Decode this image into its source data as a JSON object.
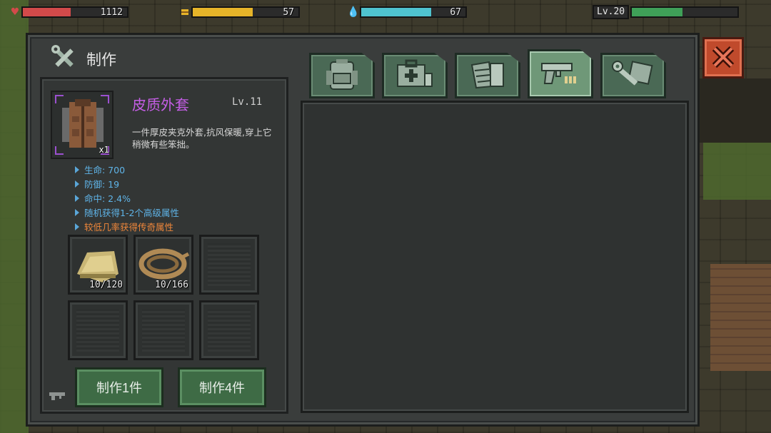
{
  "hud": {
    "health": {
      "value": "1112",
      "fraction": 0.46,
      "color": "#d24a4a"
    },
    "food": {
      "value": "57",
      "fraction": 0.57,
      "color": "#e6b429"
    },
    "water": {
      "value": "67",
      "fraction": 0.67,
      "color": "#4fc3cf"
    },
    "level": {
      "label": "Lv.20",
      "fraction": 0.48,
      "color": "#3fa058"
    }
  },
  "panel": {
    "title": "制作",
    "title_icon": "wrench-screwdriver-icon"
  },
  "item": {
    "name": "皮质外套",
    "level": "Lv.11",
    "quantity": "x1",
    "icon": "leather-jacket-icon",
    "description": "一件厚皮夹克外套,抗风保暖,穿上它稍微有些笨拙。",
    "stats": [
      {
        "text": "生命: 700",
        "color": "#5fb4e8"
      },
      {
        "text": "防御: 19",
        "color": "#5fb4e8"
      },
      {
        "text": "命中: 2.4%",
        "color": "#5fb4e8"
      },
      {
        "text": "随机获得1-2个高级属性",
        "color": "#5fb4e8"
      },
      {
        "text": "较低几率获得传奇属性",
        "color": "#f0873a"
      }
    ]
  },
  "materials": [
    {
      "name": "cloth-icon",
      "count": "10/120"
    },
    {
      "name": "rope-icon",
      "count": "10/166"
    },
    {
      "name": "empty",
      "count": ""
    },
    {
      "name": "empty",
      "count": ""
    },
    {
      "name": "empty",
      "count": ""
    },
    {
      "name": "empty",
      "count": ""
    }
  ],
  "buttons": {
    "craft_one": "制作1件",
    "craft_four": "制作4件"
  },
  "tabs": [
    {
      "icon": "backpack-icon",
      "active": false
    },
    {
      "icon": "medkit-icon",
      "active": false
    },
    {
      "icon": "armor-icon",
      "active": false
    },
    {
      "icon": "gun-icon",
      "active": true
    },
    {
      "icon": "tools-icon",
      "active": false
    }
  ],
  "colors": {
    "accent_green": "#6f9878",
    "rarity_purple": "#c55ee6",
    "close_red": "#c04a2c"
  }
}
